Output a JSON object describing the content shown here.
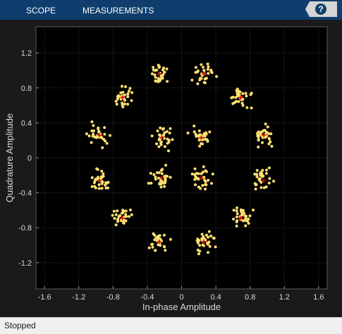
{
  "toolstrip": {
    "tabs": [
      {
        "label": "SCOPE"
      },
      {
        "label": "MEASUREMENTS"
      }
    ],
    "help_label": "?"
  },
  "status": {
    "text": "Stopped"
  },
  "colors": {
    "toolstrip_bg": "#0f3e6e",
    "plot_bg": "#000000",
    "frame_bg": "#1a1a1a",
    "point": "#ffe070",
    "reference": "#e00000"
  },
  "chart_data": {
    "type": "scatter",
    "title": "",
    "xlabel": "In-phase Amplitude",
    "ylabel": "Quadrature Amplitude",
    "xlim": [
      -1.7,
      1.7
    ],
    "ylim": [
      -1.5,
      1.5
    ],
    "xticks": [
      -1.6,
      -1.2,
      -0.8,
      -0.4,
      0,
      0.4,
      0.8,
      1.2,
      1.6
    ],
    "xtick_labels": [
      "-1.6",
      "-1.2",
      "-0.8",
      "-0.4",
      "0",
      "0.4",
      "0.8",
      "1.2",
      "1.6"
    ],
    "yticks": [
      -1.2,
      -0.8,
      -0.4,
      0,
      0.4,
      0.8,
      1.2
    ],
    "ytick_labels": [
      "-1.2",
      "-0.8",
      "-0.4",
      "0",
      "0.4",
      "0.8",
      "1.2"
    ],
    "grid": true,
    "series": [
      {
        "role": "reference",
        "marker": "plus",
        "color": "#e00000",
        "x": [
          0.23,
          0.23,
          -0.23,
          -0.23,
          0.96,
          0.96,
          -0.96,
          -0.96,
          0.69,
          -0.69,
          0.69,
          -0.69,
          0.26,
          -0.26,
          0.26,
          -0.26
        ],
        "y": [
          0.23,
          -0.23,
          0.23,
          -0.23,
          0.26,
          -0.26,
          0.26,
          -0.26,
          0.69,
          0.69,
          -0.69,
          -0.69,
          0.96,
          0.96,
          -0.96,
          -0.96
        ]
      },
      {
        "role": "received",
        "marker": "dot",
        "color": "#ffe070",
        "spread": 0.1,
        "points_per_symbol": 30,
        "centers_x": [
          0.23,
          0.23,
          -0.23,
          -0.23,
          0.96,
          0.96,
          -0.96,
          -0.96,
          0.69,
          -0.69,
          0.69,
          -0.69,
          0.26,
          -0.26,
          0.26,
          -0.26
        ],
        "centers_y": [
          0.23,
          -0.23,
          0.23,
          -0.23,
          0.26,
          -0.26,
          0.26,
          -0.26,
          0.69,
          0.69,
          -0.69,
          -0.69,
          0.96,
          0.96,
          -0.96,
          -0.96
        ]
      }
    ]
  }
}
